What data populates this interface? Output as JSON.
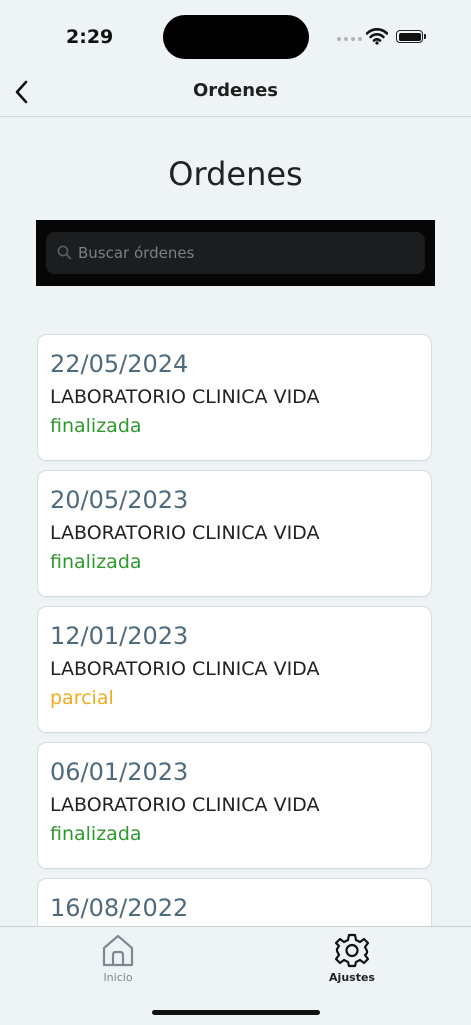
{
  "status_bar": {
    "time": "2:29"
  },
  "nav": {
    "title": "Ordenes"
  },
  "page": {
    "title": "Ordenes"
  },
  "search": {
    "placeholder": "Buscar órdenes",
    "value": ""
  },
  "colors": {
    "finalizada": "#2e9a2e",
    "parcial": "#f0ac1c",
    "date": "#4f6b7c"
  },
  "orders": [
    {
      "date": "22/05/2024",
      "lab": "LABORATORIO CLINICA VIDA",
      "status": "finalizada"
    },
    {
      "date": "20/05/2023",
      "lab": "LABORATORIO CLINICA VIDA",
      "status": "finalizada"
    },
    {
      "date": "12/01/2023",
      "lab": "LABORATORIO CLINICA VIDA",
      "status": "parcial"
    },
    {
      "date": "06/01/2023",
      "lab": "LABORATORIO CLINICA VIDA",
      "status": "finalizada"
    },
    {
      "date": "16/08/2022",
      "lab": "",
      "status": ""
    }
  ],
  "tabs": [
    {
      "label": "Inicio",
      "icon": "home-icon"
    },
    {
      "label": "Ajustes",
      "icon": "gear-icon"
    }
  ]
}
